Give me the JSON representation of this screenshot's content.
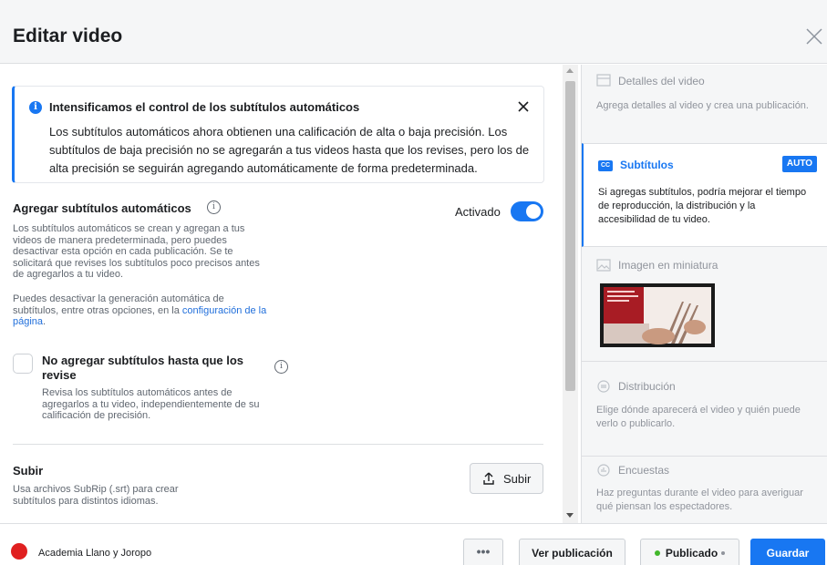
{
  "header": {
    "title": "Editar video"
  },
  "notice": {
    "title": "Intensificamos el control de los subtítulos automáticos",
    "body": "Los subtítulos automáticos ahora obtienen una calificación de alta o baja precisión. Los subtítulos de baja precisión no se agregarán a tus videos hasta que los revises, pero los de alta precisión se seguirán agregando automáticamente de forma predeterminada."
  },
  "auto_captions": {
    "title": "Agregar subtítulos automáticos",
    "toggle_label": "Activado",
    "toggle_on": true,
    "desc1": "Los subtítulos automáticos se crean y agregan a tus videos de manera predeterminada, pero puedes desactivar esta opción en cada publicación. Se te solicitará que revises los subtítulos poco precisos antes de agregarlos a tu video.",
    "desc2_prefix": "Puedes desactivar la generación automática de subtítulos, entre otras opciones, en la ",
    "desc2_link": "configuración de la página",
    "desc2_suffix": "."
  },
  "review_option": {
    "title": "No agregar subtítulos hasta que los revise",
    "checked": false,
    "desc": "Revisa los subtítulos automáticos antes de agregarlos a tu video, independientemente de su calificación de precisión."
  },
  "upload": {
    "title": "Subir",
    "desc": "Usa archivos SubRip (.srt) para crear subtítulos para distintos idiomas.",
    "button_label": "Subir"
  },
  "steps": [
    {
      "title": "Detalles del video",
      "desc": "Agrega detalles al video y crea una publicación.",
      "icon": "details-icon"
    },
    {
      "title": "Subtítulos",
      "desc": "Si agregas subtítulos, podría mejorar el tiempo de reproducción, la distribución y la accesibilidad de tu video.",
      "icon": "cc-icon",
      "badge": "AUTO",
      "active": true
    },
    {
      "title": "Imagen en miniatura",
      "icon": "image-icon"
    },
    {
      "title": "Distribución",
      "desc": "Elige dónde aparecerá el video y quién puede verlo o publicarlo.",
      "icon": "distribution-icon"
    },
    {
      "title": "Encuestas",
      "desc": "Haz preguntas durante el video para averiguar qué piensan los espectadores.",
      "icon": "poll-icon"
    }
  ],
  "footer": {
    "page_name": "Academia Llano y Joropo",
    "more_label": "•••",
    "view_label": "Ver publicación",
    "status_label": "Publicado",
    "save_label": "Guardar"
  },
  "colors": {
    "accent": "#1877f2",
    "status_green": "#42b72a",
    "avatar_red": "#e02020"
  }
}
